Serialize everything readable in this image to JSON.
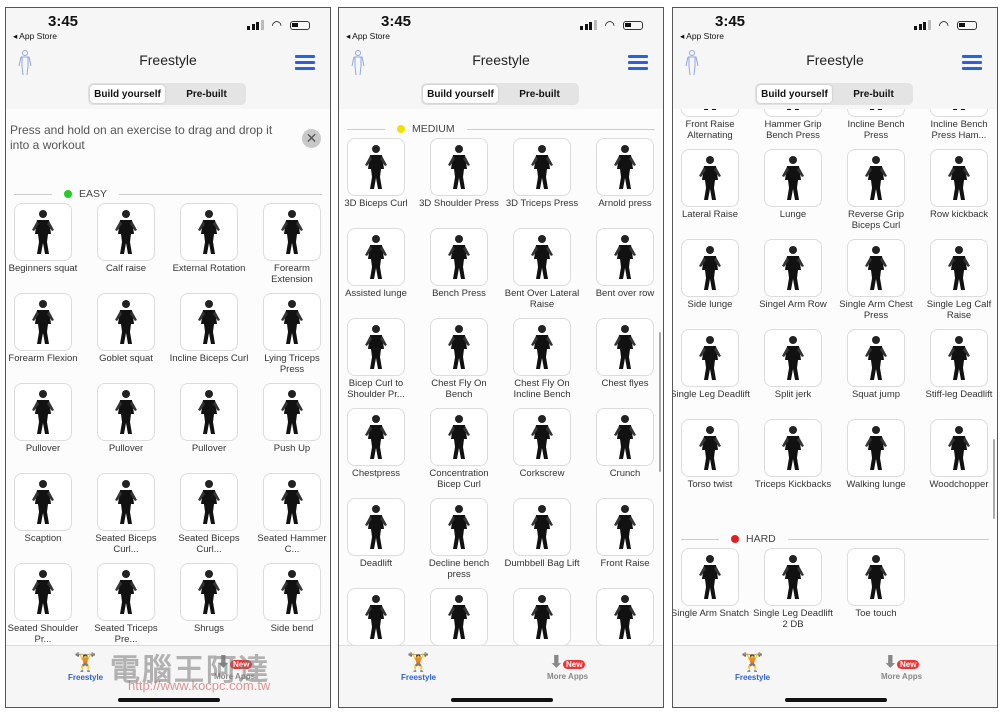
{
  "status": {
    "time": "3:45",
    "back": "◂ App Store"
  },
  "header": {
    "title": "Freestyle",
    "segments": [
      "Build yourself",
      "Pre-built"
    ],
    "active_segment": 0
  },
  "hint": {
    "text": "Press and hold on an exercise to drag and drop it into a workout",
    "close": "✕"
  },
  "tabbar": {
    "freestyle": "Freestyle",
    "more_apps": "More Apps",
    "badge": "New"
  },
  "watermark": {
    "text": "電腦王阿達",
    "url": "http://www.kocpc.com.tw"
  },
  "colors": {
    "accent": "#2d62d6",
    "easy": "#22cc22",
    "medium": "#f2e000",
    "hard": "#e02020"
  },
  "panels": [
    {
      "show_hint": true,
      "sections": [
        {
          "label": "EASY",
          "color": "#22cc22",
          "items": [
            "Beginners squat",
            "Calf raise",
            "External Rotation",
            "Forearm Extension",
            "Forearm Flexion",
            "Goblet squat",
            "Incline Biceps Curl",
            "Lying Triceps Press",
            "Pullover",
            "Pullover",
            "Pullover",
            "Push Up",
            "Scaption",
            "Seated Biceps Curl...",
            "Seated Biceps Curl...",
            "Seated Hammer C...",
            "Seated Shoulder Pr...",
            "Seated Triceps Pre...",
            "Shrugs",
            "Side bend"
          ]
        }
      ]
    },
    {
      "show_hint": false,
      "sections": [
        {
          "label": "MEDIUM",
          "color": "#f2e000",
          "items": [
            "3D Biceps Curl",
            "3D Shoulder Press",
            "3D Triceps Press",
            "Arnold press",
            "Assisted lunge",
            "Bench Press",
            "Bent Over Lateral Raise",
            "Bent over row",
            "Bicep Curl to Shoulder Pr...",
            "Chest Fly On Bench",
            "Chest Fly On Incline Bench",
            "Chest flyes",
            "Chestpress",
            "Concentration Bicep Curl",
            "Corkscrew",
            "Crunch",
            "Deadlift",
            "Decline bench press",
            "Dumbbell Bag Lift",
            "Front Raise",
            "",
            "",
            "",
            ""
          ]
        }
      ]
    },
    {
      "show_hint": false,
      "sections": [
        {
          "label": "",
          "color": "",
          "items": [
            "Front Raise Alternating",
            "Hammer Grip Bench Press",
            "Incline Bench Press",
            "Incline Bench Press Ham...",
            "Lateral Raise",
            "Lunge",
            "Reverse Grip Biceps Curl",
            "Row kickback",
            "Side lunge",
            "Singel Arm Row",
            "Single Arm Chest Press",
            "Single Leg Calf Raise",
            "Single Leg Deadlift",
            "Split jerk",
            "Squat jump",
            "Stiff-leg Deadlift",
            "Torso twist",
            "Triceps Kickbacks",
            "Walking lunge",
            "Woodchopper"
          ]
        },
        {
          "label": "HARD",
          "color": "#e02020",
          "items": [
            "Single Arm Snatch",
            "Single Leg Deadlift 2 DB",
            "Toe touch"
          ]
        }
      ]
    }
  ]
}
